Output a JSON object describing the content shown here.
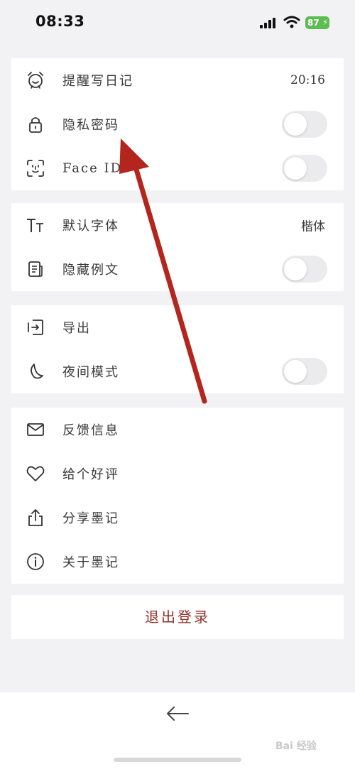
{
  "status_bar": {
    "time": "08:33",
    "battery": "87"
  },
  "sections": [
    {
      "rows": [
        {
          "label": "提醒写日记",
          "icon": "alarm-clock-icon",
          "value": "20:16"
        },
        {
          "label": "隐私密码",
          "icon": "lock-icon",
          "toggle": false
        },
        {
          "label": "Face ID",
          "icon": "face-id-icon",
          "toggle": false
        }
      ]
    },
    {
      "rows": [
        {
          "label": "默认字体",
          "icon": "font-size-icon",
          "value": "楷体"
        },
        {
          "label": "隐藏例文",
          "icon": "document-icon",
          "toggle": false
        }
      ]
    },
    {
      "rows": [
        {
          "label": "导出",
          "icon": "export-icon"
        },
        {
          "label": "夜间模式",
          "icon": "moon-icon",
          "toggle": false
        }
      ]
    },
    {
      "rows": [
        {
          "label": "反馈信息",
          "icon": "mail-icon"
        },
        {
          "label": "给个好评",
          "icon": "heart-icon"
        },
        {
          "label": "分享墨记",
          "icon": "share-icon"
        },
        {
          "label": "关于墨记",
          "icon": "info-icon"
        }
      ]
    }
  ],
  "logout_label": "退出登录",
  "watermark": "Bai 经验",
  "colors": {
    "accent": "#8e2f22",
    "annotation_arrow": "#b3261e",
    "toggle_off": "#ebebee"
  }
}
